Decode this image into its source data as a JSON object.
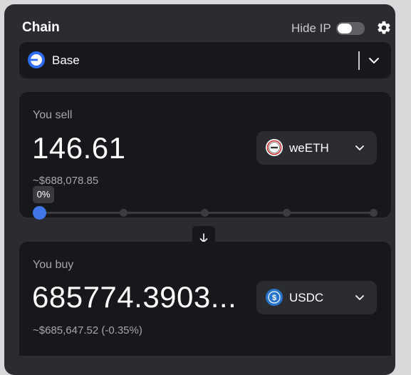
{
  "header": {
    "title": "Chain",
    "hide_ip_label": "Hide IP",
    "hide_ip_enabled": false
  },
  "chain_select": {
    "value": "Base",
    "icon": "base-logo-icon"
  },
  "sell": {
    "label": "You sell",
    "amount": "146.61",
    "usd_value": "~$688,078.85",
    "token": "weETH",
    "slider_tooltip": "0%",
    "slider_value_percent": 0,
    "slider_steps": [
      0,
      25,
      50,
      75,
      100
    ]
  },
  "buy": {
    "label": "You buy",
    "amount": "685774.3903...",
    "usd_value": "~$685,647.52 (-0.35%)",
    "token": "USDC"
  },
  "colors": {
    "accent": "#3f76e8",
    "panel": "#2b2c31",
    "card": "#17181b",
    "usdc": "#2775ca"
  },
  "icons": {
    "settings": "gear-icon",
    "swap": "arrow-down-icon",
    "dropdown": "chevron-down-icon"
  }
}
